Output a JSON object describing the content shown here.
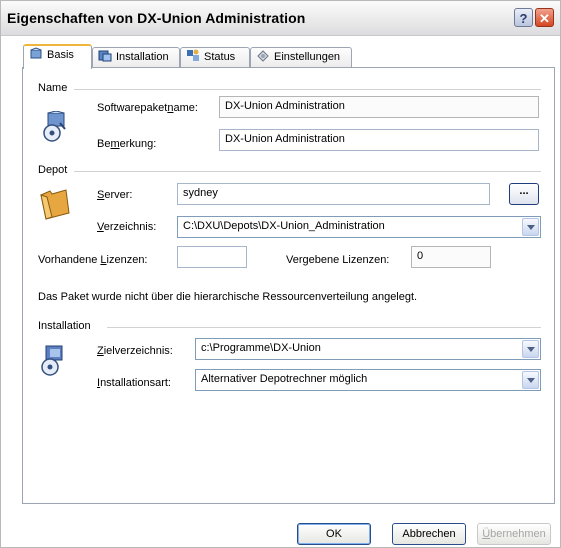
{
  "window": {
    "title": "Eigenschaften von DX-Union Administration",
    "help_button": "?",
    "close_button": "✕"
  },
  "tabs": [
    {
      "label": "Basis",
      "icon": "package-icon",
      "active": true
    },
    {
      "label": "Installation",
      "icon": "install-icon",
      "active": false
    },
    {
      "label": "Status",
      "icon": "status-icon",
      "active": false
    },
    {
      "label": "Einstellungen",
      "icon": "settings-icon",
      "active": false
    }
  ],
  "name_group": {
    "label": "Name",
    "package_name_label_pre": "Softwarepaket",
    "package_name_label_u": "n",
    "package_name_label_post": "ame:",
    "package_name_value": "DX-Union Administration",
    "remark_label_pre": "Be",
    "remark_label_u": "m",
    "remark_label_post": "erkung:",
    "remark_value": "DX-Union Administration"
  },
  "depot_group": {
    "label": "Depot",
    "server_label_u": "S",
    "server_label_post": "erver:",
    "server_value": "sydney",
    "browse_label": "...",
    "dir_label_u": "V",
    "dir_label_post": "erzeichnis:",
    "dir_value": "C:\\DXU\\Depots\\DX-Union_Administration",
    "licenses_available_label_pre": "Vorhandene ",
    "licenses_available_label_u": "L",
    "licenses_available_label_post": "izenzen:",
    "licenses_available_value": "",
    "licenses_assigned_label": "Vergebene Lizenzen:",
    "licenses_assigned_value": "0",
    "info_text": "Das Paket wurde nicht über die hierarchische Ressourcenverteilung angelegt."
  },
  "installation_group": {
    "label": "Installation",
    "target_label_u": "Z",
    "target_label_post": "ielverzeichnis:",
    "target_value": "c:\\Programme\\DX-Union",
    "type_label_u": "I",
    "type_label_post": "nstallationsart:",
    "type_value": "Alternativer Depotrechner möglich"
  },
  "footer": {
    "ok": "OK",
    "cancel": "Abbrechen",
    "apply_u": "Ü",
    "apply_post": "bernehmen"
  }
}
